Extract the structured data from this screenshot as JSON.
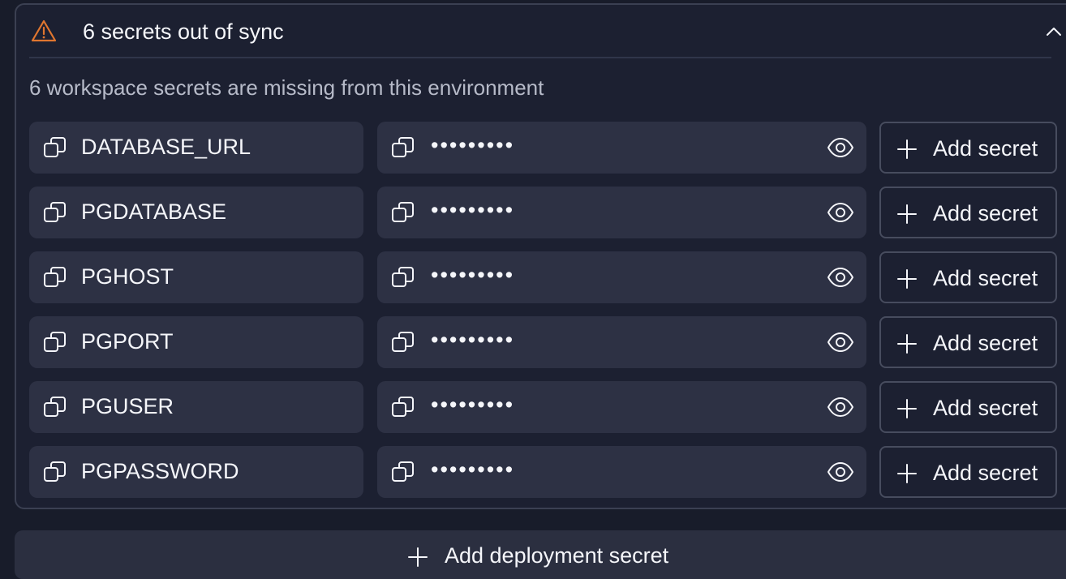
{
  "panel": {
    "title": "6 secrets out of sync",
    "description": "6 workspace secrets are missing from this environment",
    "warning_color": "#e0762f",
    "collapse_icon": "chevron-up-icon"
  },
  "secrets": [
    {
      "key": "DATABASE_URL",
      "value": "•••••••••",
      "action": "Add secret"
    },
    {
      "key": "PGDATABASE",
      "value": "•••••••••",
      "action": "Add secret"
    },
    {
      "key": "PGHOST",
      "value": "•••••••••",
      "action": "Add secret"
    },
    {
      "key": "PGPORT",
      "value": "•••••••••",
      "action": "Add secret"
    },
    {
      "key": "PGUSER",
      "value": "•••••••••",
      "action": "Add secret"
    },
    {
      "key": "PGPASSWORD",
      "value": "•••••••••",
      "action": "Add secret"
    }
  ],
  "footer": {
    "add_deployment_label": "Add deployment secret"
  },
  "icons": {
    "copy": "copy-icon",
    "reveal": "eye-icon",
    "add": "plus-icon",
    "warning": "warning-triangle-icon"
  }
}
